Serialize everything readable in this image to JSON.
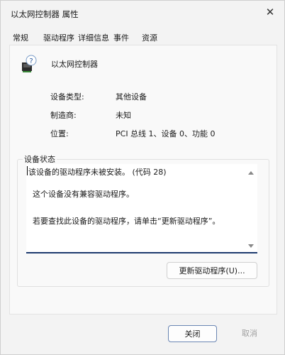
{
  "window": {
    "title": "以太网控制器 属性"
  },
  "tabs": [
    {
      "label": "常规"
    },
    {
      "label": "驱动程序"
    },
    {
      "label": "详细信息"
    },
    {
      "label": "事件"
    },
    {
      "label": "资源"
    }
  ],
  "device": {
    "name": "以太网控制器",
    "icon": "unknown-device-icon"
  },
  "properties": [
    {
      "label": "设备类型:",
      "value": "其他设备"
    },
    {
      "label": "制造商:",
      "value": "未知"
    },
    {
      "label": "位置:",
      "value": "PCI 总线 1、设备 0、功能 0"
    }
  ],
  "status": {
    "group_label": "设备状态",
    "lines": [
      "该设备的驱动程序未被安装。 (代码 28)",
      "这个设备没有兼容驱动程序。",
      "若要查找此设备的驱动程序，请单击“更新驱动程序”。"
    ]
  },
  "buttons": {
    "update_driver": "更新驱动程序(U)...",
    "close": "关闭",
    "cancel": "取消"
  }
}
